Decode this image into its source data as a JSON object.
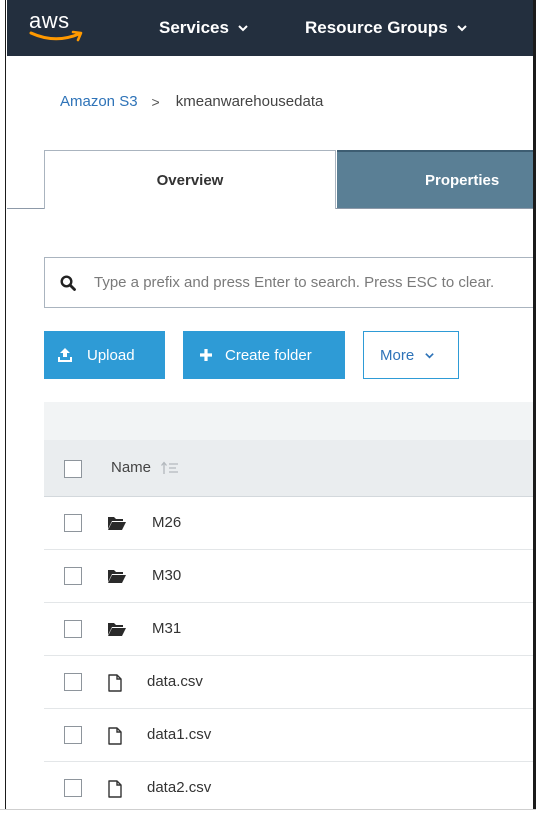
{
  "colors": {
    "nav_bg": "#232f3e",
    "accent": "#2e9bd6",
    "link": "#2e73b8",
    "tab_inactive_bg": "#5a7f95"
  },
  "nav": {
    "logo_text": "aws",
    "services_label": "Services",
    "resource_groups_label": "Resource Groups"
  },
  "breadcrumb": {
    "root": "Amazon S3",
    "separator": ">",
    "current": "kmeanwarehousedata"
  },
  "tabs": [
    {
      "label": "Overview",
      "active": true
    },
    {
      "label": "Properties",
      "active": false
    }
  ],
  "search": {
    "icon": "search-icon",
    "placeholder": "Type a prefix and press Enter to search. Press ESC to clear."
  },
  "actions": {
    "upload_label": "Upload",
    "create_folder_label": "Create folder",
    "more_label": "More"
  },
  "table": {
    "column_name": "Name",
    "rows": [
      {
        "type": "folder",
        "name": "M26"
      },
      {
        "type": "folder",
        "name": "M30"
      },
      {
        "type": "folder",
        "name": "M31"
      },
      {
        "type": "file",
        "name": "data.csv"
      },
      {
        "type": "file",
        "name": "data1.csv"
      },
      {
        "type": "file",
        "name": "data2.csv"
      }
    ]
  }
}
